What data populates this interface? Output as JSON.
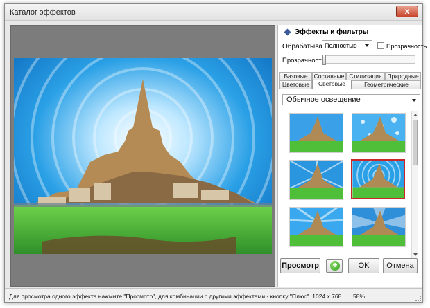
{
  "window": {
    "title": "Каталог эффектов",
    "close_glyph": "x"
  },
  "panel": {
    "header": "Эффекты и фильтры",
    "process_label": "Обрабатывать",
    "process_value": "Полностью",
    "transparency_checkbox_label": "Прозрачность",
    "transparency_slider_label": "Прозрачность",
    "transparency_level": 0,
    "tabs_row1": [
      "Базовые",
      "Составные",
      "Стилизация",
      "Природные"
    ],
    "tabs_row2": [
      "Цветовые",
      "Световые",
      "Геометрические"
    ],
    "active_tab": "Световые",
    "effect_preset": "Обычное освещение",
    "thumbnails": [
      {
        "name": "thumb-1",
        "selected": false
      },
      {
        "name": "thumb-2",
        "selected": false
      },
      {
        "name": "thumb-3",
        "selected": false
      },
      {
        "name": "thumb-4",
        "selected": true
      },
      {
        "name": "thumb-5",
        "selected": false
      },
      {
        "name": "thumb-6",
        "selected": false
      }
    ]
  },
  "buttons": {
    "preview": "Просмотр",
    "plus": "+",
    "ok": "OK",
    "cancel": "Отмена"
  },
  "status": {
    "message": "Для просмотра одного эффекта нажмите \"Просмотр\", для комбинации с другими эффектами - кнопку \"Плюс\"",
    "dimensions": "1024 x 768",
    "zoom": "58%"
  },
  "colors": {
    "accent_selected": "#c8282c",
    "sky": "#2aa0e6",
    "grass": "#4fbf3a"
  },
  "icons": {
    "plus": "plus-circle-icon",
    "header_marker": "diamond-icon"
  }
}
